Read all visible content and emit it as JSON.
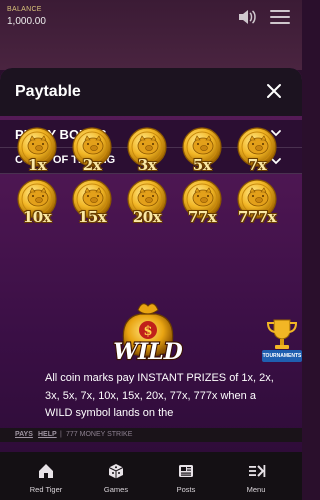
{
  "header": {
    "balance_label": "BALANCE",
    "balance_value": "1,000.00",
    "speaker_icon": "speaker-icon",
    "menu_icon": "hamburger-icon"
  },
  "sheet": {
    "title": "Paytable",
    "close_icon": "close-icon",
    "section": "PIGGY BONUS",
    "subsection": "COINS OF THE PIG"
  },
  "coins": [
    "1x",
    "2x",
    "3x",
    "5x",
    "7x",
    "10x",
    "15x",
    "20x",
    "77x",
    "777x"
  ],
  "wild_label": "WILD",
  "tournaments_label": "TOURNAMENTS",
  "description": "All coin marks pay INSTANT PRIZES of 1x, 2x, 3x, 5x, 7x, 10x, 15x, 20x, 77x, 777x when a WILD symbol lands on the",
  "footer_links": {
    "pays": "PAYS",
    "help": "HELP",
    "separator": "|",
    "game_name": "777 MONEY STRIKE"
  },
  "bottom_nav": [
    {
      "label": "Red Tiger",
      "icon": "home-icon"
    },
    {
      "label": "Games",
      "icon": "cube-icon"
    },
    {
      "label": "Posts",
      "icon": "newspaper-icon"
    },
    {
      "label": "Menu",
      "icon": "menu-arrow-icon"
    }
  ],
  "colors": {
    "accent_gold": "#f2b625",
    "sheet_purple": "#4a1550",
    "nav_bg": "#141014"
  }
}
